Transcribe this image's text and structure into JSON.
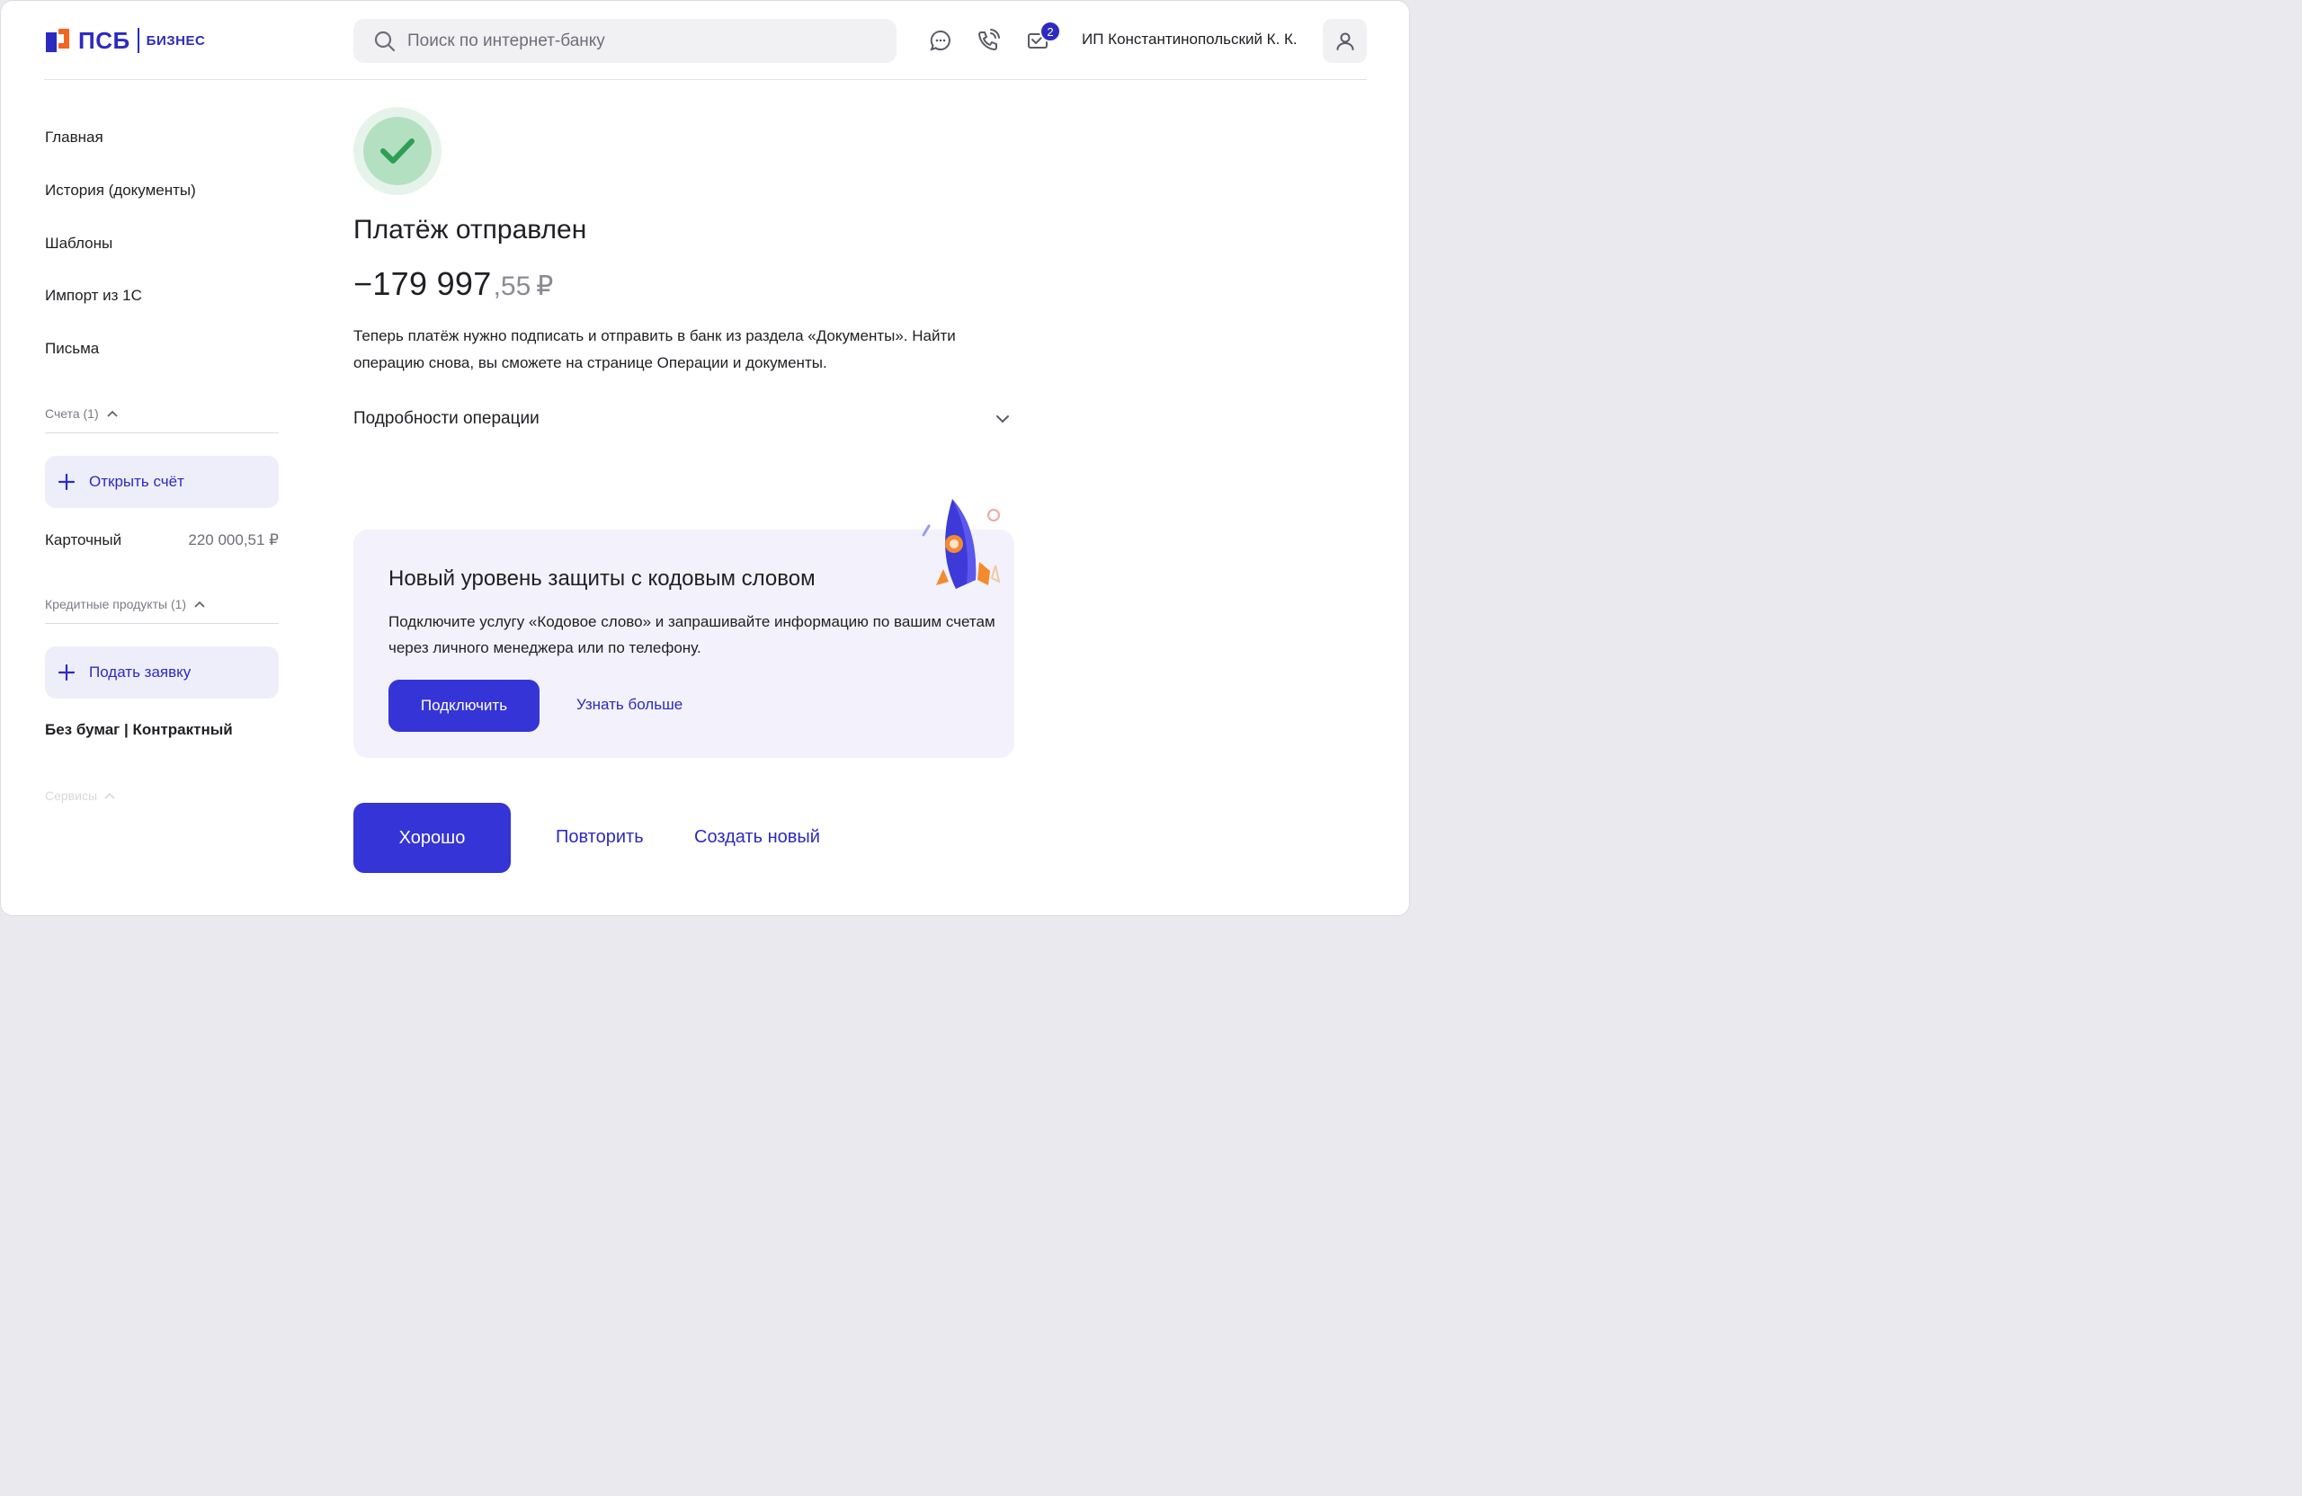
{
  "header": {
    "logo_text": "ПСБ",
    "logo_sub": "БИЗНЕС",
    "search_placeholder": "Поиск по интернет-банку",
    "mail_count": "2",
    "username": "ИП Константинопольский К. К."
  },
  "sidebar": {
    "nav": [
      "Главная",
      "История (документы)",
      "Шаблоны",
      "Импорт из 1С",
      "Письма"
    ],
    "accounts_header": "Счета (1)",
    "open_account": "Открыть счёт",
    "account": {
      "name": "Карточный",
      "balance": "220 000,51 ₽"
    },
    "credit_header": "Кредитные продукты (1)",
    "apply": "Подать заявку",
    "no_paper": "Без бумаг | Контрактный",
    "services_header": "Сервисы"
  },
  "main": {
    "title": "Платёж отправлен",
    "amount_int": "−179 997",
    "amount_frac": ",55",
    "amount_currency": "₽",
    "description": "Теперь платёж нужно подписать и отправить в банк из раздела «Документы». Найти операцию снова, вы сможете на странице Операции и документы.",
    "details_label": "Подробности операции"
  },
  "promo": {
    "title": "Новый уровень защиты с кодовым словом",
    "text": "Подключите услугу «Кодовое слово» и запрашивайте информацию по вашим счетам через личного менеджера или по телефону.",
    "connect": "Подключить",
    "more": "Узнать больше"
  },
  "actions": {
    "ok": "Хорошо",
    "repeat": "Повторить",
    "create_new": "Создать новый"
  },
  "colors": {
    "accent": "#3534d6",
    "link": "#2d2ac1",
    "success_bg": "#b4e0c2",
    "success_check": "#2f9e55",
    "promo_bg": "#f3f2fc"
  }
}
